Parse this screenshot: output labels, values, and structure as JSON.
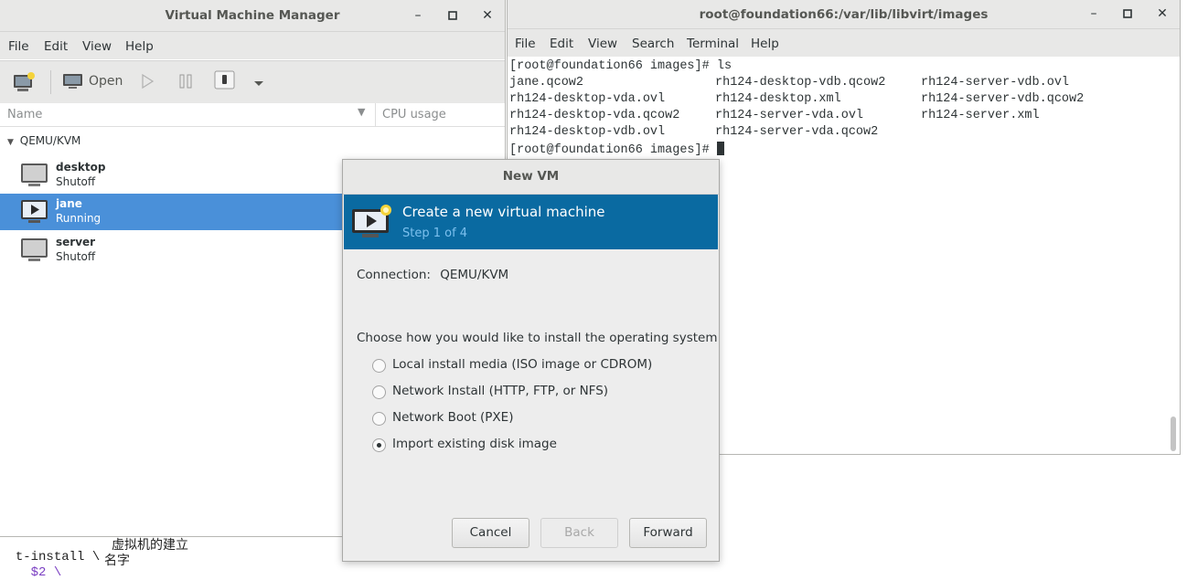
{
  "background": {
    "line1_cmd": "t-install \\",
    "line1_note": "虚拟机的建立",
    "line2_cmd": "  $2 \\",
    "line2_note": "名字"
  },
  "vmm": {
    "title": "Virtual Machine Manager",
    "menu": [
      "File",
      "Edit",
      "View",
      "Help"
    ],
    "toolbar": {
      "open_label": "Open"
    },
    "columns": {
      "name": "Name",
      "cpu": "CPU usage"
    },
    "group": "QEMU/KVM",
    "vms": [
      {
        "name": "desktop",
        "state": "Shutoff"
      },
      {
        "name": "jane",
        "state": "Running"
      },
      {
        "name": "server",
        "state": "Shutoff"
      }
    ]
  },
  "terminal": {
    "title": "root@foundation66:/var/lib/libvirt/images",
    "menu": [
      "File",
      "Edit",
      "View",
      "Search",
      "Terminal",
      "Help"
    ],
    "prompt1": "[root@foundation66 images]# ls",
    "files_col1": [
      "jane.qcow2",
      "rh124-desktop-vda.ovl",
      "rh124-desktop-vda.qcow2",
      "rh124-desktop-vdb.ovl"
    ],
    "files_col2": [
      "rh124-desktop-vdb.qcow2",
      "rh124-desktop.xml",
      "rh124-server-vda.ovl",
      "rh124-server-vda.qcow2"
    ],
    "files_col3": [
      "rh124-server-vdb.ovl",
      "rh124-server-vdb.qcow2",
      "rh124-server.xml"
    ],
    "prompt2": "[root@foundation66 images]# "
  },
  "dialog": {
    "title": "New VM",
    "heading": "Create a new virtual machine",
    "step": "Step 1 of 4",
    "connection_label": "Connection:",
    "connection_value": "QEMU/KVM",
    "question": "Choose how you would like to install the operating system",
    "options": [
      {
        "label": "Local install media (ISO image or CDROM)",
        "selected": false
      },
      {
        "label": "Network Install (HTTP, FTP, or NFS)",
        "selected": false
      },
      {
        "label": "Network Boot (PXE)",
        "selected": false
      },
      {
        "label": "Import existing disk image",
        "selected": true
      }
    ],
    "buttons": {
      "cancel": "Cancel",
      "back": "Back",
      "forward": "Forward"
    }
  },
  "colors": {
    "accent": "#0a6aa1",
    "selection": "#4a90d9"
  }
}
